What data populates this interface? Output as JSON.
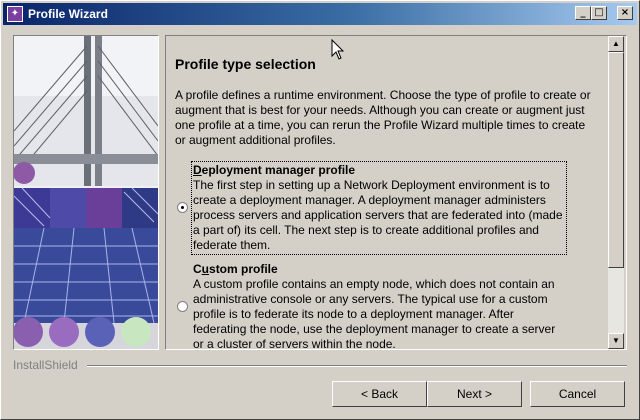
{
  "window": {
    "title": "Profile Wizard",
    "controls": {
      "minimize": "_",
      "maximize": "□",
      "close": "×"
    }
  },
  "content": {
    "heading": "Profile type selection",
    "intro": "A profile defines a runtime environment. Choose the type of profile to create or augment that is best for your needs. Although you can create or augment just one profile at a time, you can rerun the Profile Wizard multiple times to create or augment additional profiles.",
    "options": [
      {
        "title_prefix": "",
        "title_mnemonic": "D",
        "title_rest": "eployment manager profile",
        "description": "The first step in setting up a Network Deployment environment is to create a deployment manager. A deployment manager administers process servers and application servers that are federated into (made a part of) its cell. The next step is to create additional profiles and federate them.",
        "selected": true
      },
      {
        "title_prefix": "C",
        "title_mnemonic": "u",
        "title_rest": "stom profile",
        "description": "A custom profile contains an empty node, which does not contain an administrative console or any servers. The typical use for a custom profile is to federate its node to a deployment manager. After federating the node, use the deployment manager to create a server or a cluster of servers within the node.",
        "selected": false
      }
    ]
  },
  "footer": {
    "brand": "InstallShield",
    "buttons": {
      "back": "< Back",
      "next": "Next >",
      "cancel": "Cancel"
    }
  },
  "icons": {
    "app": "profile-wizard-icon",
    "scroll_up": "▲",
    "scroll_down": "▼"
  },
  "colors": {
    "title_bar_start": "#0a246a",
    "title_bar_end": "#a6caf0",
    "face": "#d4d0c8"
  }
}
